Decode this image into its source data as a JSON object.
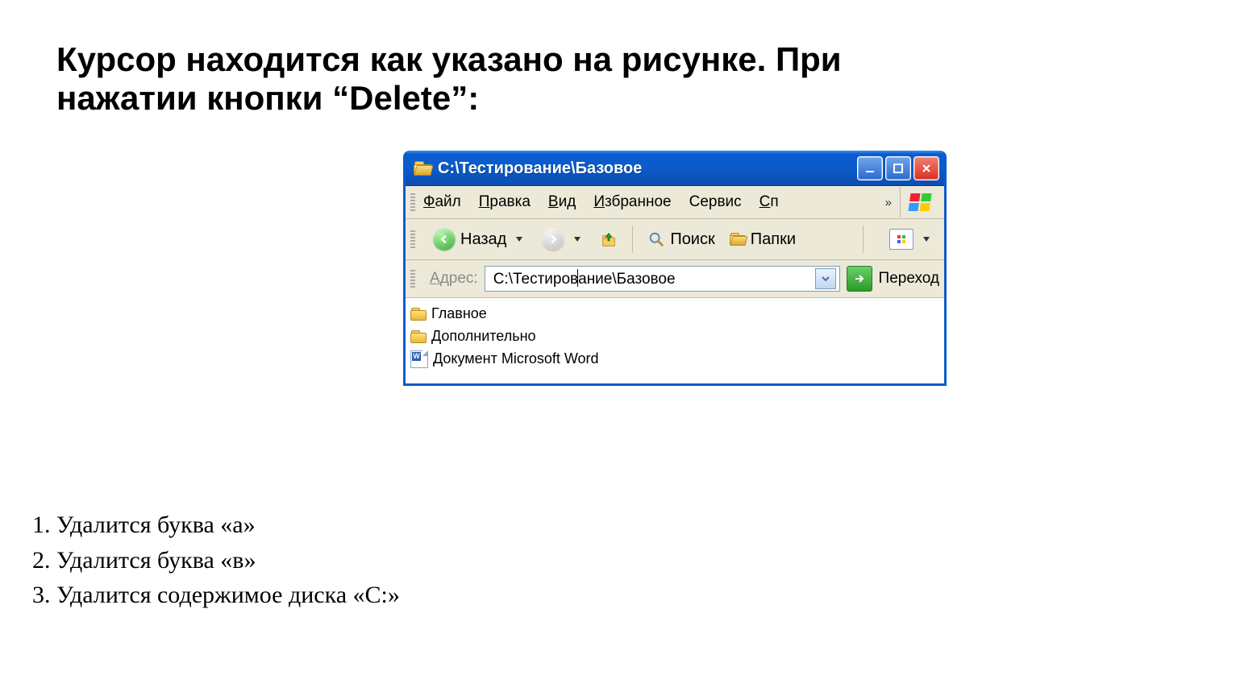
{
  "question": "Курсор находится как указано на рисунке. При нажатии  кнопки “Delete”:",
  "answers": [
    "1. Удалится буква «а»",
    "2. Удалится буква «в»",
    "3. Удалится содержимое диска «С:»"
  ],
  "window": {
    "title": "C:\\Тестирование\\Базовое",
    "menu": {
      "file": "Файл",
      "edit": "Правка",
      "view": "Вид",
      "favorites": "Избранное",
      "tools": "Сервис",
      "help_trunc": "Сп",
      "overflow": "»"
    },
    "toolbar": {
      "back": "Назад",
      "search": "Поиск",
      "folders": "Папки"
    },
    "address": {
      "label": "Адрес:",
      "before_caret": "С:\\Тестиров",
      "after_caret": "ание\\Базовое",
      "go": "Переход"
    },
    "items": [
      {
        "type": "folder",
        "name": "Главное"
      },
      {
        "type": "folder",
        "name": "Дополнительно"
      },
      {
        "type": "word",
        "name": "Документ Microsoft Word"
      }
    ]
  }
}
